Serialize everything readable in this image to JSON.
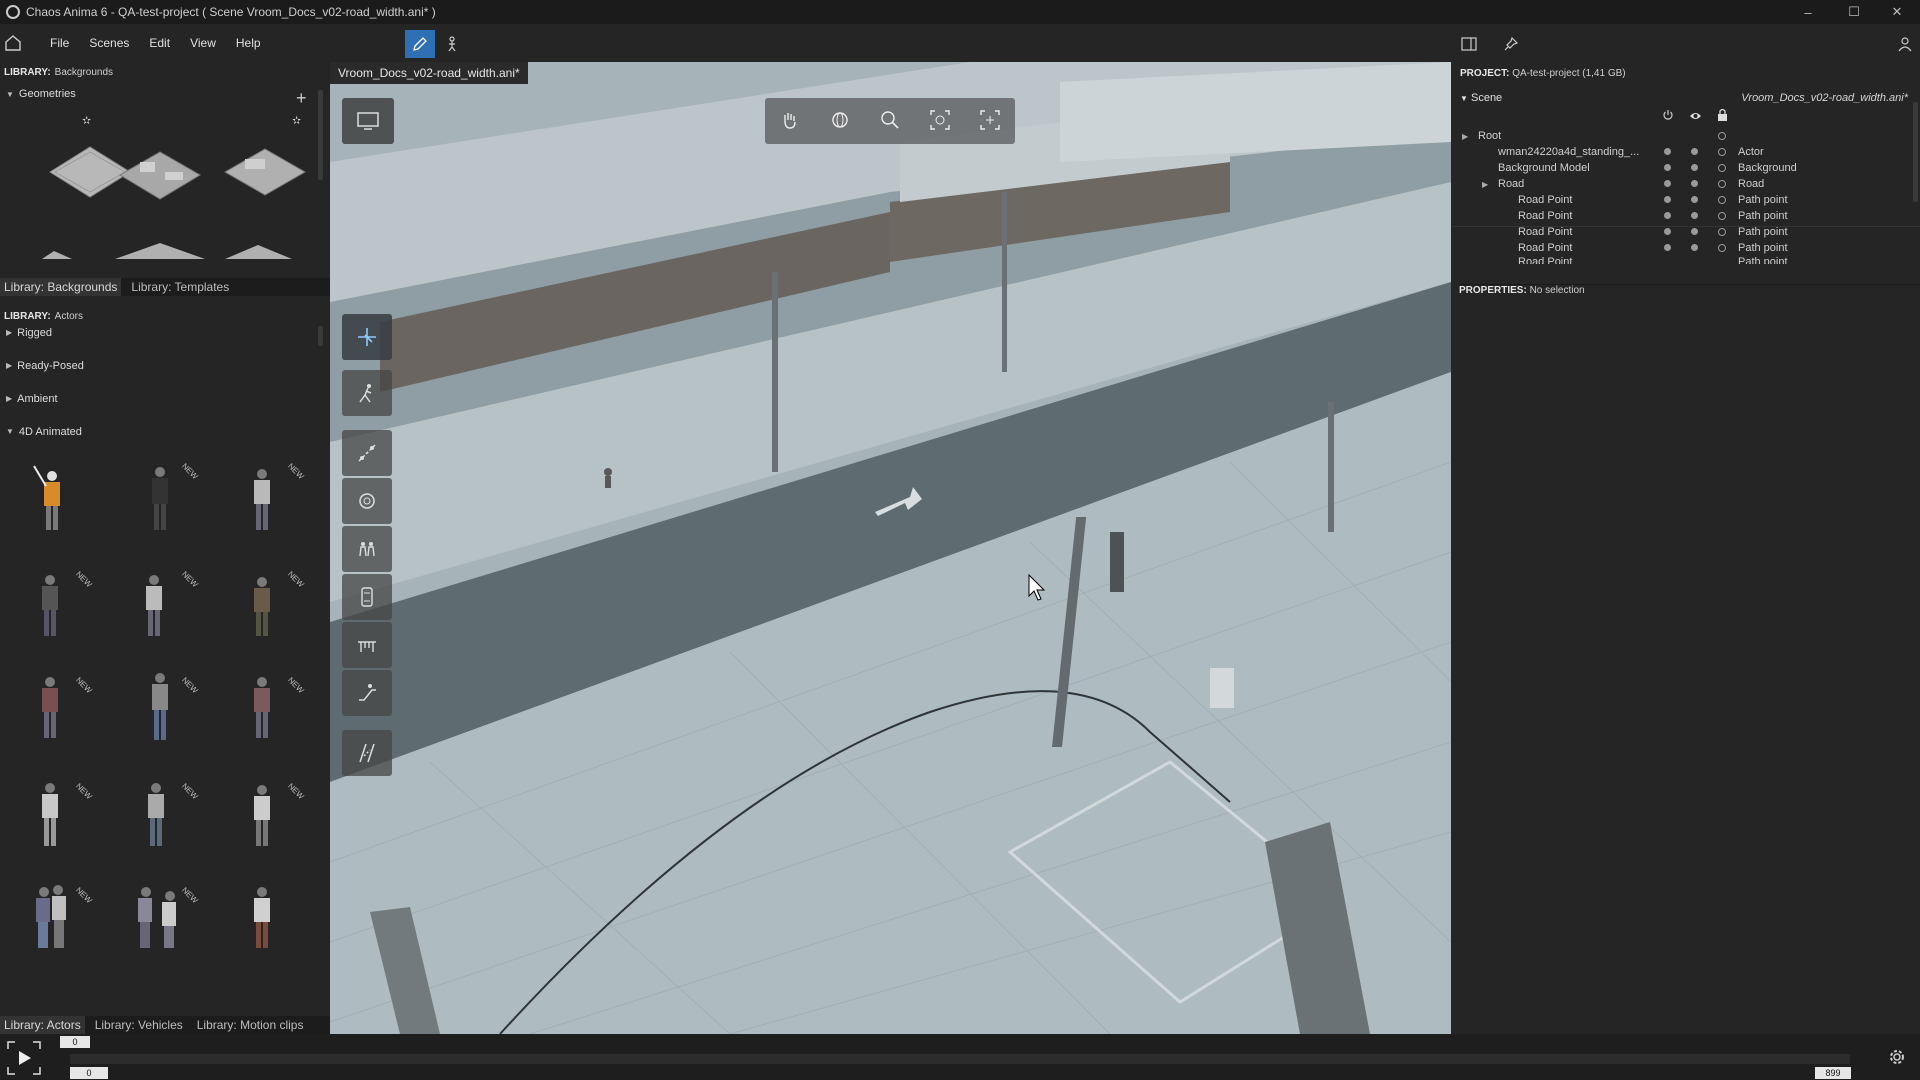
{
  "window": {
    "title": "Chaos Anima 6 -  QA-test-project ( Scene Vroom_Docs_v02-road_width.ani* )",
    "controls": [
      "–",
      "☐",
      "✕"
    ]
  },
  "menu": {
    "items": [
      "File",
      "Scenes",
      "Edit",
      "View",
      "Help"
    ],
    "icons": {
      "home": "home-icon",
      "edit_mode": "pencil-icon",
      "walk_mode": "person-icon",
      "panel_toggle": "panel-icon",
      "pin": "pin-icon",
      "user": "user-icon"
    }
  },
  "left": {
    "library_top_label": "LIBRARY:",
    "library_top_value": "Backgrounds",
    "geometries_label": "Geometries",
    "tabs_top": [
      "Library: Backgrounds",
      "Library: Templates"
    ],
    "library_actor_label": "LIBRARY:",
    "library_actor_value": "Actors",
    "categories": [
      "Rigged",
      "Ready-Posed",
      "Ambient",
      "4D Animated"
    ],
    "new_badge": "NEW",
    "tabs_bottom": [
      "Library: Actors",
      "Library: Vehicles",
      "Library: Motion clips"
    ]
  },
  "viewport": {
    "tab": "Vroom_Docs_v02-road_width.ani*",
    "top_tools": [
      "hand-icon",
      "orbit-icon",
      "zoom-icon",
      "zoom-fit-icon",
      "frame-icon"
    ],
    "side_tools": [
      "select-move-icon",
      "actor-path-icon",
      "path-edit-icon",
      "rotate-icon",
      "group-icon",
      "vehicle-icon",
      "crowd-icon",
      "escalator-icon",
      "road-icon"
    ]
  },
  "right": {
    "project_label": "PROJECT:",
    "project_value": "QA-test-project (1,41 GB)",
    "scene_label": "Scene",
    "scene_file": "Vroom_Docs_v02-road_width.ani*",
    "rows": [
      {
        "name": "Root",
        "type": ""
      },
      {
        "name": "wman24220a4d_standing_...",
        "type": "Actor"
      },
      {
        "name": "Background Model",
        "type": "Background"
      },
      {
        "name": "Road",
        "type": "Road"
      },
      {
        "name": "Road Point",
        "type": "Path point"
      },
      {
        "name": "Road Point",
        "type": "Path point"
      },
      {
        "name": "Road Point",
        "type": "Path point"
      },
      {
        "name": "Road Point",
        "type": "Path point"
      },
      {
        "name": "Road Point",
        "type": "Path point"
      }
    ],
    "properties_label": "PROPERTIES:",
    "properties_value": "No selection"
  },
  "timeline": {
    "start_frame_top": "0",
    "start_frame": "0",
    "end_frame": "899"
  }
}
